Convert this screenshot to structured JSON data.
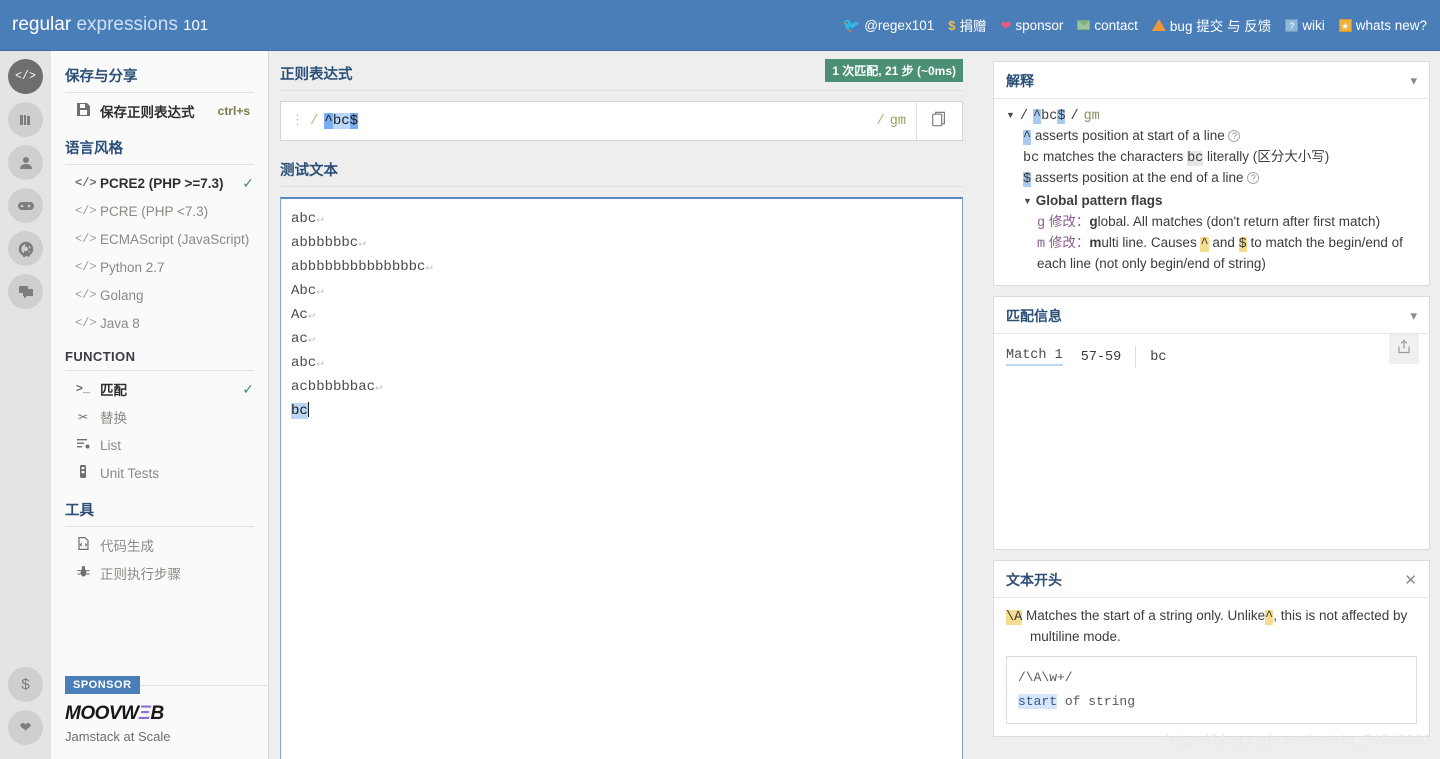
{
  "topbar": {
    "brand_1": "regular",
    "brand_2": "expressions",
    "brand_3": "101",
    "nav": [
      {
        "icon": "twitter-icon",
        "label": "@regex101"
      },
      {
        "icon": "dollar-icon",
        "label": "捐赠"
      },
      {
        "icon": "heart-icon",
        "label": "sponsor"
      },
      {
        "icon": "mail-icon",
        "label": "contact"
      },
      {
        "icon": "warning-triangle-icon",
        "label": "bug 提交 与 反馈"
      },
      {
        "icon": "wiki-icon",
        "label": "wiki"
      },
      {
        "icon": "whats-new-icon",
        "label": "whats new?"
      }
    ]
  },
  "rail": {
    "items": [
      {
        "icon": "code-icon",
        "active": true
      },
      {
        "icon": "library-icon",
        "active": false
      },
      {
        "icon": "account-icon",
        "active": false
      },
      {
        "icon": "gamepad-icon",
        "active": false
      },
      {
        "icon": "gear-icon",
        "active": false
      },
      {
        "icon": "chat-icon",
        "active": false
      }
    ],
    "bottom": [
      {
        "icon": "dollar-icon"
      },
      {
        "icon": "heart-icon"
      }
    ]
  },
  "sidebar": {
    "save_section": {
      "title": "保存与分享",
      "item_label": "保存正则表达式",
      "item_icon": "floppy-disk-icon",
      "shortcut": "ctrl+s"
    },
    "flavor_section": {
      "title": "语言风格",
      "items": [
        {
          "label": "PCRE2 (PHP >=7.3)",
          "selected": true
        },
        {
          "label": "PCRE (PHP <7.3)",
          "selected": false
        },
        {
          "label": "ECMAScript (JavaScript)",
          "selected": false
        },
        {
          "label": "Python 2.7",
          "selected": false
        },
        {
          "label": "Golang",
          "selected": false
        },
        {
          "label": "Java 8",
          "selected": false
        }
      ]
    },
    "function_section": {
      "title": "FUNCTION",
      "items": [
        {
          "label": "匹配",
          "icon": "prompt-icon",
          "selected": true
        },
        {
          "label": "替换",
          "icon": "scissors-icon",
          "selected": false
        },
        {
          "label": "List",
          "icon": "list-icon",
          "selected": false
        },
        {
          "label": "Unit Tests",
          "icon": "test-tube-icon",
          "selected": false
        }
      ]
    },
    "tools_section": {
      "title": "工具",
      "items": [
        {
          "label": "代码生成",
          "icon": "code-file-icon"
        },
        {
          "label": "正则执行步骤",
          "icon": "bug-icon"
        }
      ]
    },
    "sponsor": {
      "tag": "SPONSOR",
      "logo_1": "MOOVW",
      "logo_2": "Ξ",
      "logo_3": "B",
      "subtitle": "Jamstack at Scale"
    }
  },
  "regex_panel": {
    "title": "正则表达式",
    "match_badge": "1 次匹配, 21 步 (~0ms)",
    "badge_color": "#4b8f74",
    "delimiter": "/",
    "pattern_parts": [
      {
        "text": "^",
        "style": "selected-dark"
      },
      {
        "text": "bc",
        "style": "selected-light"
      },
      {
        "text": "$",
        "style": "selected-dark"
      }
    ],
    "pattern": "^bc$",
    "flags": "gm",
    "copy_icon": "copy-icon",
    "drag_icon": "drag-handle-icon"
  },
  "test_panel": {
    "title": "测试文本",
    "lines": [
      {
        "text": "abc",
        "newline": true
      },
      {
        "text": "abbbbbbc",
        "newline": true
      },
      {
        "text": "abbbbbbbbbbbbbbc",
        "newline": true
      },
      {
        "text": "Abc",
        "newline": true
      },
      {
        "text": "Ac",
        "newline": true
      },
      {
        "text": "ac",
        "newline": true
      },
      {
        "text": "abc",
        "newline": true
      },
      {
        "text": "acbbbbbbac",
        "newline": true
      },
      {
        "text": "bc",
        "newline": false,
        "highlighted": true,
        "caret": true
      }
    ],
    "pilcrow": "↵"
  },
  "explanation_panel": {
    "title": "解释",
    "chevron": "chevron-down-icon",
    "header": {
      "slash_left": "/",
      "caret_token": "^",
      "literal_token": "bc",
      "dollar_token": "$",
      "slash_right": "/",
      "flags": "gm"
    },
    "rows": [
      {
        "token": "^",
        "text": "asserts position at start of a line",
        "help": true
      },
      {
        "token": "bc",
        "text_before": "matches the characters",
        "token2": "bc",
        "text_after": "literally (区分大小写)",
        "help": false
      },
      {
        "token": "$",
        "text": "asserts position at the end of a line",
        "help": true
      }
    ],
    "flags_group": {
      "title": "Global pattern flags",
      "items": [
        {
          "flag": "g",
          "modifier": "修改：",
          "bold": "g",
          "text": "lobal. All matches (don't return after first match)"
        },
        {
          "flag": "m",
          "modifier": "修改：",
          "bold": "m",
          "text_1": "ulti line. Causes",
          "tok_1": "^",
          "text_2": "and",
          "tok_2": "$",
          "text_3": "to match the begin/end of each line (not only begin/end of string)"
        }
      ]
    }
  },
  "match_info_panel": {
    "title": "匹配信息",
    "chevron": "chevron-down-icon",
    "share_icon": "share-icon",
    "matches": [
      {
        "label": "Match 1",
        "range": "57-59",
        "value": "bc"
      }
    ]
  },
  "quickref_panel": {
    "title": "文本开头",
    "close_icon": "close-icon",
    "token": "\\A",
    "description_1": "Matches the start of a string only. Unlike",
    "inline_token": "^",
    "description_2": ", this is not affected by multiline mode.",
    "example_regex": "/\\A\\w+/",
    "example_result_kw": "start",
    "example_result_rest": " of string"
  },
  "watermark": "https://blog.csdn.net/weixin_54646993"
}
